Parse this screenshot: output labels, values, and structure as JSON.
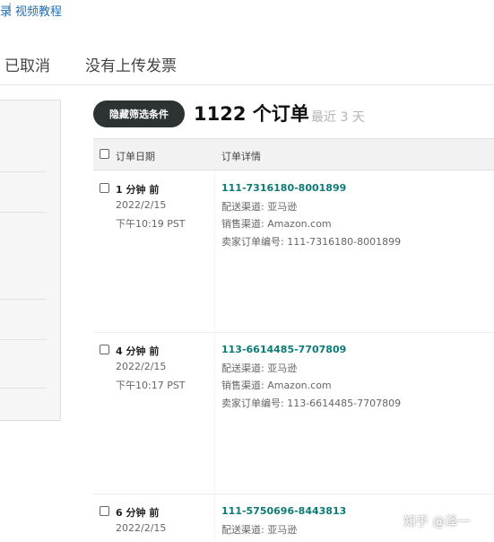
{
  "top_links": {
    "link_partial": "录",
    "separator": "|",
    "video_tutorial": "视频教程"
  },
  "tabs": {
    "cancelled": "已取消",
    "no_invoice": "没有上传发票"
  },
  "filter": {
    "hide_button": "隐藏筛选条件"
  },
  "summary": {
    "count": "1122 个订单",
    "recent": "最近 3 天"
  },
  "table_header": {
    "date_col": "订单日期",
    "detail_col": "订单详情"
  },
  "orders": [
    {
      "time_ago": "1 分钟 前",
      "date": "2022/2/15",
      "time": "下午10:19 PST",
      "order_id": "111-7316180-8001899",
      "delivery": "配送渠道: 亚马逊",
      "sales": "销售渠道: Amazon.com",
      "seller_order": "卖家订单编号: 111-7316180-8001899"
    },
    {
      "time_ago": "4 分钟 前",
      "date": "2022/2/15",
      "time": "下午10:17 PST",
      "order_id": "113-6614485-7707809",
      "delivery": "配送渠道: 亚马逊",
      "sales": "销售渠道: Amazon.com",
      "seller_order": "卖家订单编号: 113-6614485-7707809"
    },
    {
      "time_ago": "6 分钟 前",
      "date": "2022/2/15",
      "order_id": "111-5750696-8443813",
      "delivery": "配送渠道: 亚马逊"
    }
  ],
  "watermark": "知乎 @泽一"
}
